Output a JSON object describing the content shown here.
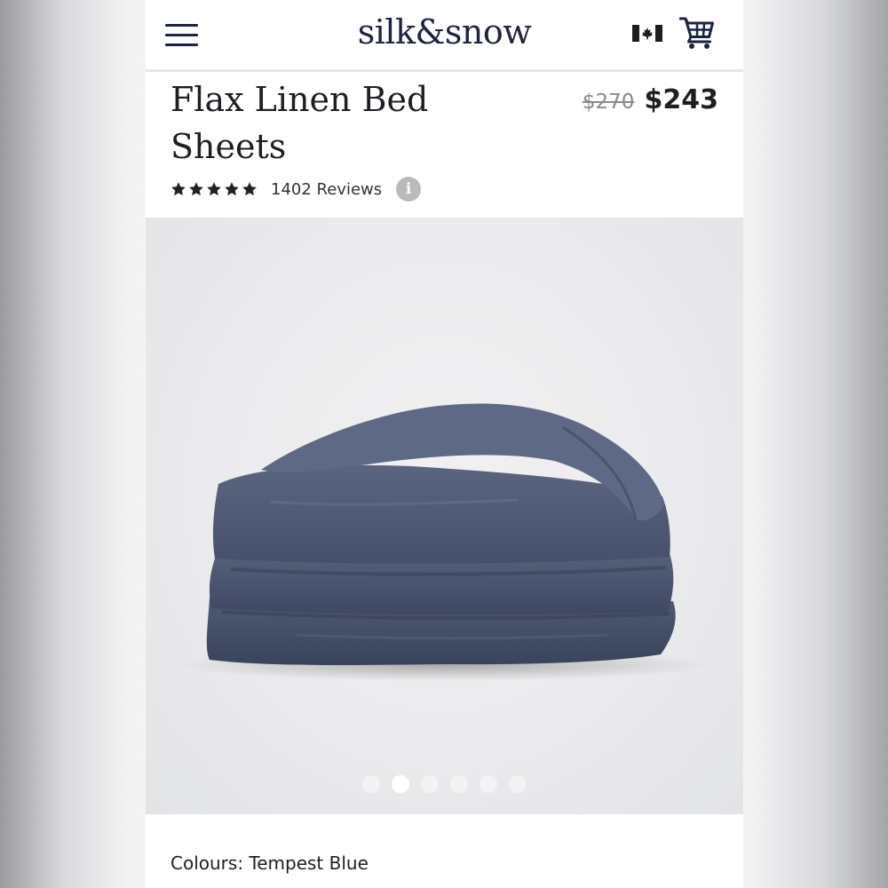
{
  "header": {
    "logo": "silk&snow",
    "menu_icon": "hamburger-menu-icon",
    "flag_icon": "canada-flag-icon",
    "cart_icon": "shopping-cart-icon"
  },
  "product": {
    "title_line1": "Flax Linen Bed",
    "title_line2": "Sheets",
    "price_original": "$270",
    "price_sale": "$243",
    "rating_stars": 5,
    "reviews_label": "1402 Reviews",
    "info_icon_glyph": "i"
  },
  "gallery": {
    "image_subject": "folded tempest blue linen duvet",
    "total_slides": 6,
    "active_slide": 2
  },
  "colours": {
    "label": "Colours: Tempest Blue"
  },
  "colors": {
    "text_dark": "#1e1f24",
    "logo_navy": "#1e2542",
    "price_strike": "#8a8a8a",
    "flag_red": "#1d1d1d",
    "fabric_blue": "#4b5672"
  }
}
